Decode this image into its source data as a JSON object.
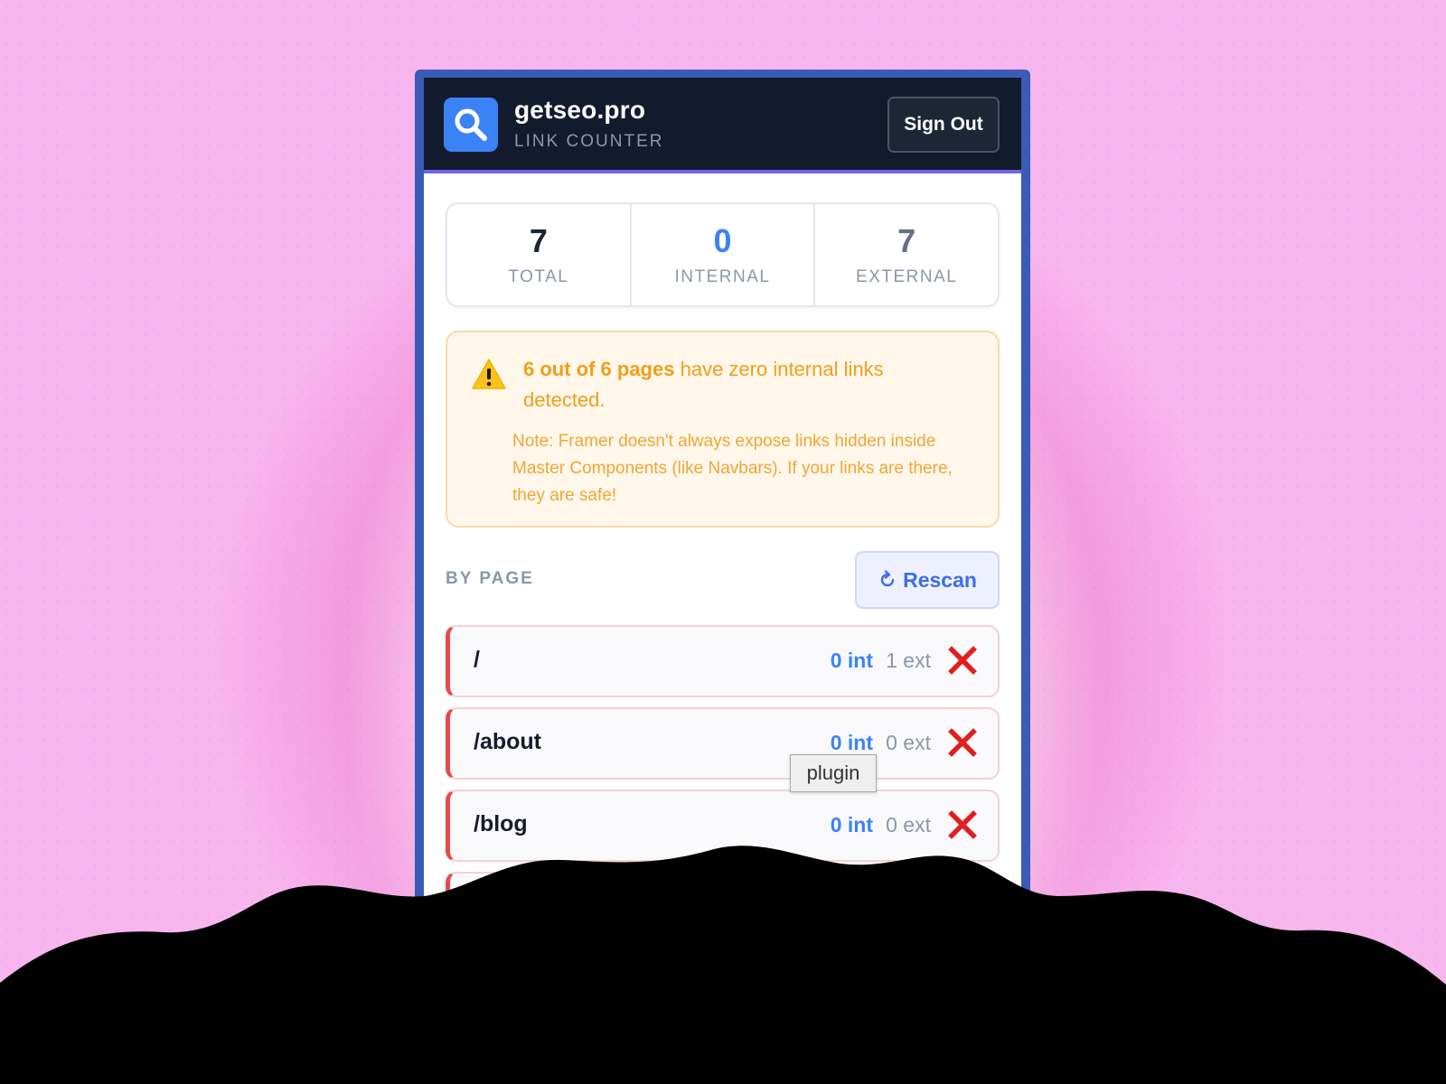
{
  "header": {
    "brand_title": "getseo.pro",
    "brand_subtitle": "LINK COUNTER",
    "sign_out_label": "Sign Out",
    "logo_icon": "magnifier-icon"
  },
  "stats": [
    {
      "value": "7",
      "label": "TOTAL"
    },
    {
      "value": "0",
      "label": "INTERNAL"
    },
    {
      "value": "7",
      "label": "EXTERNAL"
    }
  ],
  "warning": {
    "icon": "warning-triangle-icon",
    "title_strong": "6 out of 6 pages",
    "title_rest": " have zero internal links detected.",
    "note": "Note: Framer doesn't always expose links hidden inside Master Components (like Navbars). If your links are there, they are safe!"
  },
  "by_page": {
    "label": "BY PAGE",
    "rescan_label": "Rescan",
    "rescan_icon": "refresh-icon",
    "pages": [
      {
        "path": "/",
        "int": "0 int",
        "ext": "1 ext"
      },
      {
        "path": "/about",
        "int": "0 int",
        "ext": "0 ext"
      },
      {
        "path": "/blog",
        "int": "0 int",
        "ext": "0 ext"
      }
    ],
    "status_icon": "red-x-icon"
  },
  "tooltip": {
    "text": "plugin"
  },
  "colors": {
    "accent": "#3b82f6",
    "header_bg": "#121a2e",
    "warning": "#ef9f1b",
    "error": "#e84a4a",
    "frame": "#3a5bb6",
    "background": "#f8b6ee"
  }
}
